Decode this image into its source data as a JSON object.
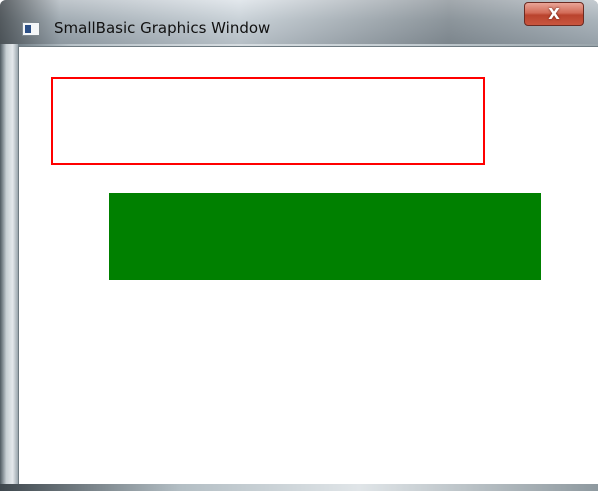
{
  "window": {
    "title": "SmallBasic Graphics Window",
    "close_label": "X"
  },
  "canvas": {
    "background_color": "#ffffff",
    "shapes": [
      {
        "kind": "rectangle",
        "style": "outline",
        "color": "#ff0000"
      },
      {
        "kind": "rectangle",
        "style": "filled",
        "color": "#008000"
      }
    ]
  }
}
